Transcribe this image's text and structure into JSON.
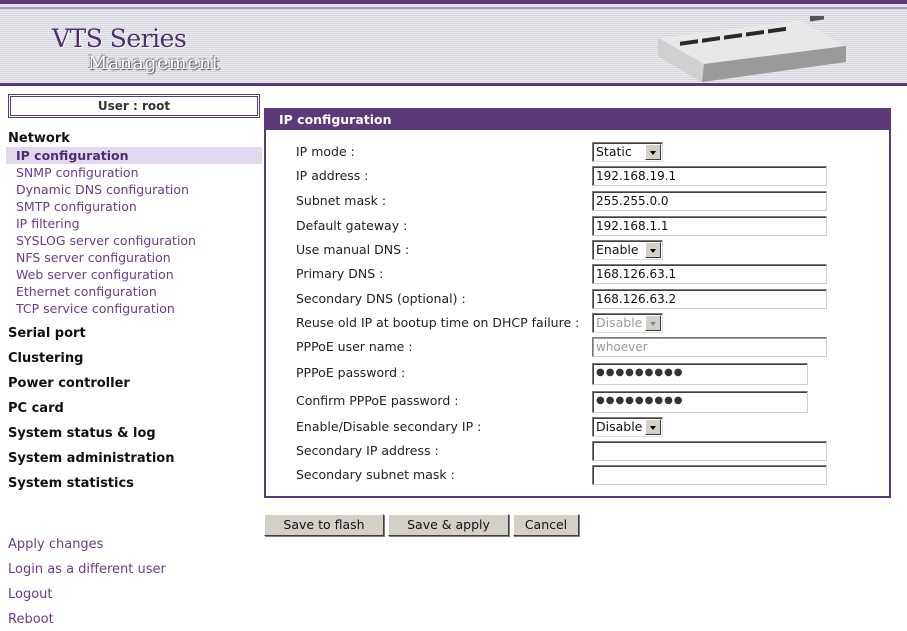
{
  "header": {
    "title": "VTS Series",
    "subtitle": "Management"
  },
  "sidebar": {
    "user_label": "User : root",
    "network_heading": "Network",
    "network_items": [
      {
        "label": "IP configuration",
        "active": true
      },
      {
        "label": "SNMP configuration"
      },
      {
        "label": "Dynamic DNS configuration"
      },
      {
        "label": "SMTP configuration"
      },
      {
        "label": "IP filtering"
      },
      {
        "label": "SYSLOG server configuration"
      },
      {
        "label": "NFS server configuration"
      },
      {
        "label": "Web server configuration"
      },
      {
        "label": "Ethernet configuration"
      },
      {
        "label": "TCP service configuration"
      }
    ],
    "sections": [
      "Serial port",
      "Clustering",
      "Power controller",
      "PC card",
      "System status & log",
      "System administration",
      "System statistics"
    ],
    "bottom_links": [
      "Apply changes",
      "Login as a different user",
      "Logout",
      "Reboot"
    ]
  },
  "panel": {
    "title": "IP configuration",
    "rows": [
      {
        "label": "IP mode :",
        "type": "select",
        "value": "Static"
      },
      {
        "label": "IP address :",
        "type": "text",
        "value": "192.168.19.1"
      },
      {
        "label": "Subnet mask :",
        "type": "text",
        "value": "255.255.0.0"
      },
      {
        "label": "Default gateway :",
        "type": "text",
        "value": "192.168.1.1"
      },
      {
        "label": "Use manual DNS :",
        "type": "select",
        "value": "Enable"
      },
      {
        "label": "Primary DNS :",
        "type": "text",
        "value": "168.126.63.1"
      },
      {
        "label": "Secondary DNS (optional) :",
        "type": "text",
        "value": "168.126.63.2"
      },
      {
        "label": "Reuse old IP at bootup time on DHCP failure :",
        "type": "select",
        "value": "Disable",
        "disabled": true
      },
      {
        "label": "PPPoE user name :",
        "type": "text",
        "value": "whoever",
        "disabled": true
      },
      {
        "label": "PPPoE password :",
        "type": "password",
        "value": "●●●●●●●●●"
      },
      {
        "label": "Confirm PPPoE password :",
        "type": "password",
        "value": "●●●●●●●●●"
      },
      {
        "label": "Enable/Disable secondary IP :",
        "type": "select",
        "value": "Disable"
      },
      {
        "label": "Secondary IP address :",
        "type": "text",
        "value": ""
      },
      {
        "label": "Secondary subnet mask :",
        "type": "text",
        "value": ""
      }
    ]
  },
  "buttons": {
    "save_flash": "Save to flash",
    "save_apply": "Save & apply",
    "cancel": "Cancel"
  },
  "colors": {
    "accent": "#5a3a77",
    "link": "#6a3b8f",
    "active_bg": "#e3d7ee"
  }
}
